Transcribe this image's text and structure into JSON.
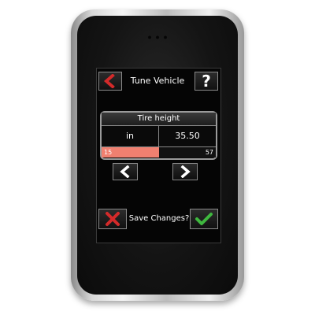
{
  "header": {
    "title": "Tune Vehicle",
    "back_icon": "back-arrow-icon",
    "help_icon": "question-mark-icon"
  },
  "setting": {
    "name": "Tire height",
    "unit": "in",
    "value": "35.50",
    "range_min": "15",
    "range_max": "57",
    "level_fraction": 0.5
  },
  "navigation": {
    "prev_icon": "chevron-left-icon",
    "next_icon": "chevron-right-icon"
  },
  "save_prompt": {
    "text": "Save Changes?",
    "cancel_icon": "x-icon",
    "confirm_icon": "checkmark-icon"
  },
  "colors": {
    "back_arrow": "#d42a2a",
    "range_fill": "#f08070",
    "cancel_x": "#d42a2a",
    "confirm_check": "#3fb83f"
  }
}
